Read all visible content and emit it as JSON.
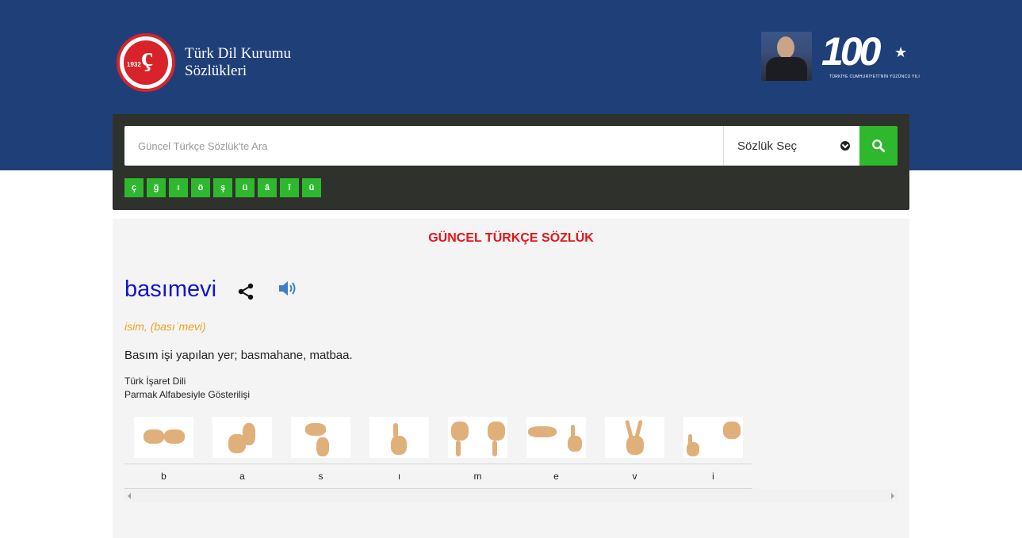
{
  "header": {
    "logo_year": "1932",
    "logo_mark": "TDK",
    "logo_line1": "Türk Dil Kurumu",
    "logo_line2": "Sözlükleri",
    "centennial_number": "100",
    "centennial_caption": "TÜRKİYE CUMHURİYETİ'NİN YÜZÜNCÜ YILI"
  },
  "search": {
    "placeholder": "Güncel Türkçe Sözlük'te Ara",
    "value": "",
    "dictionary_select": "Sözlük Seç",
    "special_chars": [
      "ç",
      "ğ",
      "ı",
      "ö",
      "ş",
      "ü",
      "â",
      "î",
      "û"
    ]
  },
  "result": {
    "dictionary_title": "GÜNCEL TÜRKÇE SÖZLÜK",
    "word": "basımevi",
    "meta": "isim, (basıˈmevi)",
    "definition": "Basım işi yapılan yer; basmahane, matbaa.",
    "sign_language_line1": "Türk İşaret Dili",
    "sign_language_line2": "Parmak Alfabesiyle Gösterilişi",
    "letters": [
      "b",
      "a",
      "s",
      "ı",
      "m",
      "e",
      "v",
      "i"
    ]
  },
  "colors": {
    "header_bg": "#1f3f79",
    "search_panel_bg": "#2f312c",
    "accent_green": "#2eb82e",
    "title_red": "#e3151a",
    "word_blue": "#1212d6",
    "meta_orange": "#f0a11e"
  },
  "icons": {
    "search_button": "search-icon",
    "share": "share-icon",
    "sound": "speaker-icon",
    "select": "chevron-down-icon"
  }
}
